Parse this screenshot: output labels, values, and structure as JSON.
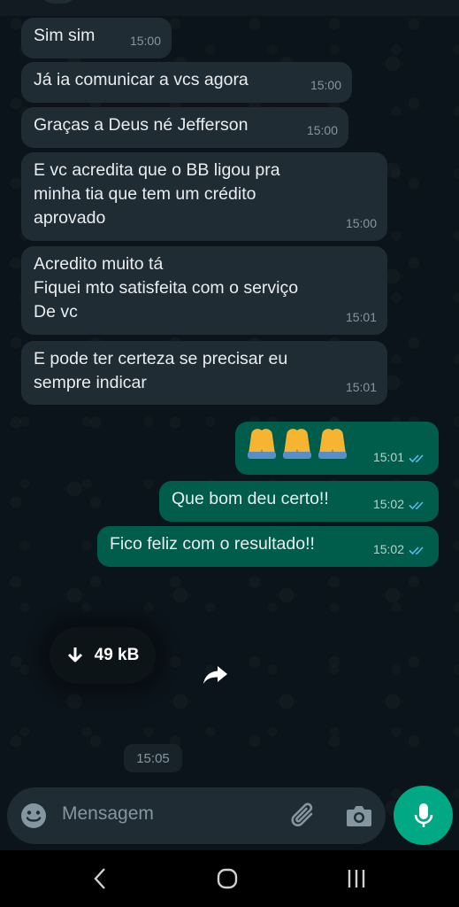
{
  "messages": [
    {
      "text": "Sim sim",
      "time": "15:00"
    },
    {
      "text": "Já ia comunicar a vcs agora",
      "time": "15:00"
    },
    {
      "text": "Graças a Deus né Jefferson",
      "time": "15:00"
    },
    {
      "text": "E vc acredita que o BB ligou pra\nminha tia que tem um crédito\naprovado",
      "time": "15:00"
    },
    {
      "text": "Acredito muito tá\nFiquei mto satisfeita com o serviço\nDe vc",
      "time": "15:01"
    },
    {
      "text": "E pode ter certeza se precisar eu\nsempre indicar",
      "time": "15:01"
    },
    {
      "text": "🙏 🙏 🙏",
      "time": "15:01"
    },
    {
      "text": "Que bom deu certo!!",
      "time": "15:02"
    },
    {
      "text": "Fico feliz com o resultado!!",
      "time": "15:02"
    }
  ],
  "attachment": {
    "size": "49 kB",
    "time": "15:05",
    "icon": "download-arrow-icon"
  },
  "composer": {
    "placeholder": "Mensagem"
  },
  "colors": {
    "background": "#0b141a",
    "incoming_bubble": "#1f2c34",
    "outgoing_bubble": "#005c4b",
    "accent": "#00a884",
    "read_ticks": "#53bdeb"
  }
}
